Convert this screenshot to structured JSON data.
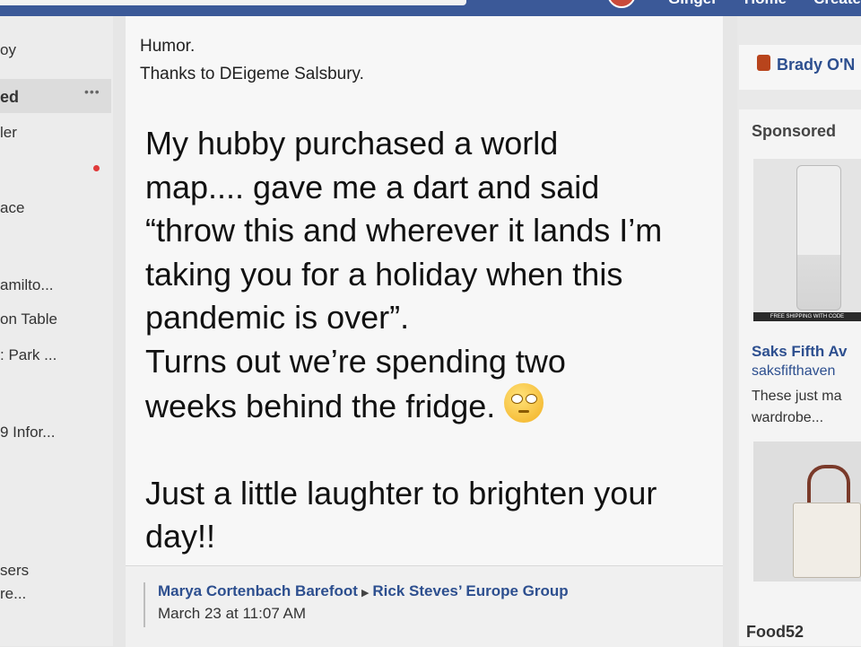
{
  "topbar": {
    "nav": [
      "Ginger",
      "Home",
      "Create"
    ]
  },
  "sidebar": {
    "items": [
      {
        "label": "oy",
        "bold": false
      },
      {
        "label": "ed",
        "bold": true
      },
      {
        "label": "ler",
        "bold": false
      },
      {
        "label": "ace",
        "bold": false
      },
      {
        "label": "amilto...",
        "bold": false
      },
      {
        "label": "on Table",
        "bold": false
      },
      {
        "label": ": Park ...",
        "bold": false
      },
      {
        "label": "9 Infor...",
        "bold": false
      },
      {
        "label": "sers",
        "bold": false
      },
      {
        "label": "re...",
        "bold": false
      }
    ],
    "more_label": "•••"
  },
  "post": {
    "header_lines": [
      "Humor.",
      "Thanks to DEigeme Salsbury."
    ],
    "body_lines": [
      "My hubby purchased a world",
      "map.... gave me a dart and said",
      "“throw this and wherever it lands I’m",
      "taking you for a holiday when this",
      "pandemic is over”.",
      "Turns out we’re spending two",
      "weeks behind the fridge."
    ],
    "emoji": "face-with-rolling-eyes",
    "closing_lines": [
      "Just a little laughter to brighten your",
      "day!!"
    ],
    "author": "Marya Cortenbach Barefoot",
    "group": "Rick Steves’ Europe Group",
    "timestamp": "March 23 at 11:07 AM"
  },
  "right": {
    "contact_name": "Brady O'N",
    "sponsored_label": "Sponsored",
    "ad1": {
      "strip_text": "FREE SHIPPING WITH CODE",
      "title": "Saks Fifth Av",
      "subtitle": "saksfifthaven",
      "desc_lines": [
        "These just ma",
        "wardrobe..."
      ]
    },
    "ad2": {
      "title": "Food52"
    }
  }
}
